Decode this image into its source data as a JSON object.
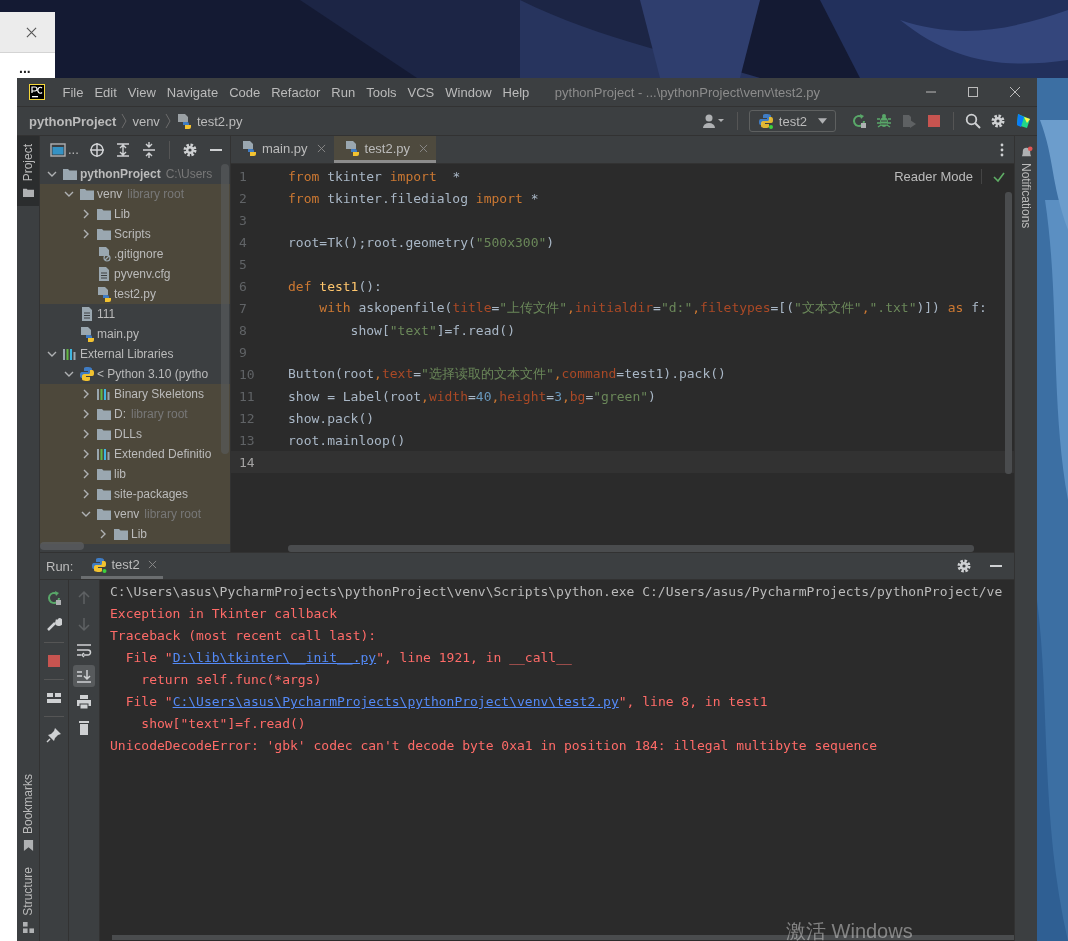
{
  "desktop": {
    "activation_notice": "激活 Windows"
  },
  "browser_window": {
    "more_label": "..."
  },
  "ide": {
    "menu": [
      "File",
      "Edit",
      "View",
      "Navigate",
      "Code",
      "Refactor",
      "Run",
      "Tools",
      "VCS",
      "Window",
      "Help"
    ],
    "title": "pythonProject - ...\\pythonProject\\venv\\test2.py",
    "breadcrumb": [
      "pythonProject",
      "venv",
      "test2.py"
    ],
    "run_config": "test2",
    "left_stripe_top": [
      {
        "label": "Project",
        "selected": true
      }
    ],
    "left_stripe_bottom": [
      {
        "label": "Bookmarks",
        "selected": false
      },
      {
        "label": "Structure",
        "selected": false
      }
    ],
    "right_stripe": {
      "label": "Notifications"
    },
    "project_toolbar_label": "...",
    "project_tree": [
      {
        "label": "pythonProject",
        "hint": "C:\\Users",
        "kind": "project",
        "expanded": true,
        "library": false,
        "children": [
          {
            "label": "venv",
            "hint": "library root",
            "kind": "folder",
            "expanded": true,
            "library": true,
            "children": [
              {
                "label": "Lib",
                "kind": "folder",
                "expanded": false,
                "library": true
              },
              {
                "label": "Scripts",
                "kind": "folder",
                "expanded": false,
                "library": true
              },
              {
                "label": ".gitignore",
                "kind": "file-ignore",
                "library": true
              },
              {
                "label": "pyvenv.cfg",
                "kind": "file-text",
                "library": true
              },
              {
                "label": "test2.py",
                "kind": "file-python",
                "library": true
              }
            ]
          },
          {
            "label": "111",
            "kind": "file-text",
            "library": false
          },
          {
            "label": "main.py",
            "kind": "file-python",
            "library": false
          }
        ]
      },
      {
        "label": "External Libraries",
        "kind": "libraries",
        "expanded": true,
        "library": false,
        "children": [
          {
            "label": "< Python 3.10 (pytho",
            "kind": "sdk",
            "expanded": true,
            "library": false,
            "children": [
              {
                "label": "Binary Skeletons",
                "kind": "libraries",
                "expanded": false,
                "library": true
              },
              {
                "label": "D:",
                "hint": "library root",
                "kind": "folder",
                "expanded": false,
                "library": true
              },
              {
                "label": "DLLs",
                "kind": "folder",
                "expanded": false,
                "library": true
              },
              {
                "label": "Extended Definitio",
                "kind": "libraries",
                "expanded": false,
                "library": true
              },
              {
                "label": "lib",
                "kind": "folder",
                "expanded": false,
                "library": true
              },
              {
                "label": "site-packages",
                "kind": "folder",
                "expanded": false,
                "library": true
              },
              {
                "label": "venv",
                "hint": "library root",
                "kind": "folder",
                "expanded": true,
                "library": true,
                "children": [
                  {
                    "label": "Lib",
                    "kind": "folder",
                    "expanded": false,
                    "library": true
                  }
                ]
              }
            ]
          }
        ]
      }
    ],
    "tabs": [
      {
        "label": "main.py",
        "selected": false
      },
      {
        "label": "test2.py",
        "selected": true
      }
    ],
    "reader_mode": "Reader Mode",
    "code": [
      {
        "number": "1",
        "current": false,
        "tokens": [
          {
            "kw": "from"
          },
          {
            "plain": " tkinter "
          },
          {
            "kw": "import"
          },
          {
            "plain": "  *"
          }
        ]
      },
      {
        "number": "2",
        "current": false,
        "tokens": [
          {
            "kw": "from"
          },
          {
            "plain": " tkinter.filedialog "
          },
          {
            "kw": "import"
          },
          {
            "plain": " *"
          }
        ]
      },
      {
        "number": "3",
        "current": false
      },
      {
        "number": "4",
        "current": false,
        "tokens": [
          {
            "plain": "root=Tk();root.geometry("
          },
          {
            "str": "\"500x300\""
          },
          {
            "plain": ")"
          }
        ]
      },
      {
        "number": "5",
        "current": false
      },
      {
        "number": "6",
        "current": false,
        "tokens": [
          {
            "kw": "def "
          },
          {
            "fn": "test1"
          },
          {
            "plain": "():"
          }
        ]
      },
      {
        "number": "7",
        "current": false,
        "tokens": [
          {
            "kw": "    with"
          },
          {
            "plain": " askopenfile("
          },
          {
            "param": "title"
          },
          {
            "plain": "="
          },
          {
            "str": "\"上传文件\""
          },
          {
            "kw": ","
          },
          {
            "param": "initialdir"
          },
          {
            "plain": "="
          },
          {
            "str": "\"d:\""
          },
          {
            "kw": ","
          },
          {
            "param": "filetypes"
          },
          {
            "plain": "=[("
          },
          {
            "str": "\"文本文件\""
          },
          {
            "kw": ","
          },
          {
            "str": "\".txt\""
          },
          {
            "plain": ")]) "
          },
          {
            "kw": "as"
          },
          {
            "plain": " f:"
          }
        ]
      },
      {
        "number": "8",
        "current": false,
        "tokens": [
          {
            "plain": "        show["
          },
          {
            "str": "\"text\""
          },
          {
            "plain": "]=f.read()"
          }
        ]
      },
      {
        "number": "9",
        "current": false
      },
      {
        "number": "10",
        "current": false,
        "tokens": [
          {
            "plain": "Button(root"
          },
          {
            "kw": ","
          },
          {
            "param": "text"
          },
          {
            "plain": "="
          },
          {
            "str": "\"选择读取的文本文件\""
          },
          {
            "kw": ","
          },
          {
            "param": "command"
          },
          {
            "plain": "=test1).pack()"
          }
        ]
      },
      {
        "number": "11",
        "current": false,
        "tokens": [
          {
            "plain": "show = Label(root"
          },
          {
            "kw": ","
          },
          {
            "param": "width"
          },
          {
            "plain": "="
          },
          {
            "num": "40"
          },
          {
            "kw": ","
          },
          {
            "param": "height"
          },
          {
            "plain": "="
          },
          {
            "num": "3"
          },
          {
            "kw": ","
          },
          {
            "param": "bg"
          },
          {
            "plain": "="
          },
          {
            "str": "\"green\""
          },
          {
            "plain": ")"
          }
        ]
      },
      {
        "number": "12",
        "current": false,
        "tokens": [
          {
            "plain": "show.pack()"
          }
        ]
      },
      {
        "number": "13",
        "current": false,
        "tokens": [
          {
            "plain": "root.mainloop()"
          }
        ]
      },
      {
        "number": "14",
        "current": true
      }
    ],
    "run_label": "Run:",
    "run_tab": "test2",
    "console": [
      [
        {
          "out": "C:\\Users\\asus\\PycharmProjects\\pythonProject\\venv\\Scripts\\python.exe C:/Users/asus/PycharmProjects/pythonProject/ve"
        }
      ],
      [
        {
          "err": "Exception in Tkinter callback"
        }
      ],
      [
        {
          "err": "Traceback (most recent call last):"
        }
      ],
      [
        {
          "err": "  File \""
        },
        {
          "link": "D:\\lib\\tkinter\\__init__.py"
        },
        {
          "err": "\", line 1921, in __call__"
        }
      ],
      [
        {
          "err": "    return self.func(*args)"
        }
      ],
      [
        {
          "err": "  File \""
        },
        {
          "link": "C:\\Users\\asus\\PycharmProjects\\pythonProject\\venv\\test2.py"
        },
        {
          "err": "\", line 8, in test1"
        }
      ],
      [
        {
          "err": "    show[\"text\"]=f.read()"
        }
      ],
      [
        {
          "err": "UnicodeDecodeError: 'gbk' codec can't decode byte 0xa1 in position 184: illegal multibyte sequence"
        }
      ]
    ]
  }
}
